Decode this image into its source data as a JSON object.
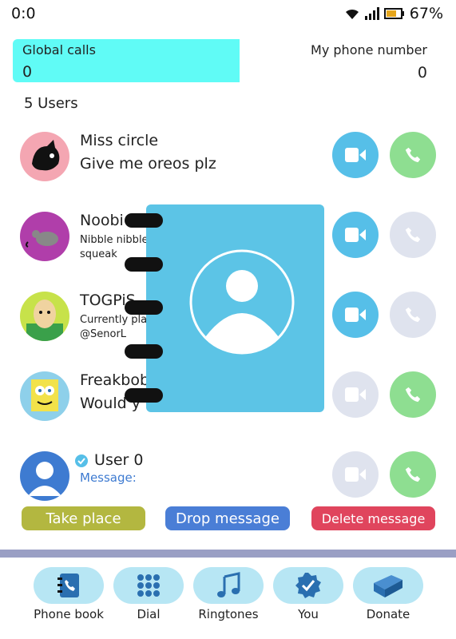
{
  "status": {
    "time": "0:0",
    "battery": "67%"
  },
  "global": {
    "label": "Global calls",
    "value": "0"
  },
  "myphone": {
    "label": "My phone number",
    "value": "0"
  },
  "users_count": "5 Users",
  "users": [
    {
      "name": "Miss circle",
      "message": "Give me oreos plz",
      "video": "active",
      "call": "active",
      "avatar_color": "#f4a6b2"
    },
    {
      "name": "Noobi",
      "message_line1": "Nibble nibble",
      "message_line2": "squeak",
      "video": "active",
      "call": "disabled",
      "avatar_color": "#b03eaa"
    },
    {
      "name": "TOGPiS",
      "message_line1": "Currently pla",
      "message_line2": "@SenorL",
      "video": "active",
      "call": "disabled",
      "avatar_color": "#c7e24a"
    },
    {
      "name": "Freakbob",
      "message": "Would y",
      "video": "disabled",
      "call": "active",
      "avatar_color": "#8ed0ea"
    },
    {
      "name": "User 0",
      "message_label": "Message:",
      "video": "disabled",
      "call": "active",
      "avatar_color": "#3e7bd1"
    }
  ],
  "actions": {
    "take_place": "Take place",
    "drop_message": "Drop message",
    "delete_message": "Delete message"
  },
  "nav": [
    {
      "label": "Phone book",
      "icon": "phone-book-icon"
    },
    {
      "label": "Dial",
      "icon": "dialpad-icon"
    },
    {
      "label": "Ringtones",
      "icon": "music-note-icon"
    },
    {
      "label": "You",
      "icon": "verified-badge-icon"
    },
    {
      "label": "Donate",
      "icon": "box-icon"
    }
  ],
  "colors": {
    "accent_cyan": "#60fbf6",
    "video_blue": "#56bfe8",
    "call_green": "#8ede91",
    "disabled": "#dfe3ee",
    "take_place": "#b3b740",
    "drop_message": "#4a7ed6",
    "delete_message": "#e0455d"
  }
}
